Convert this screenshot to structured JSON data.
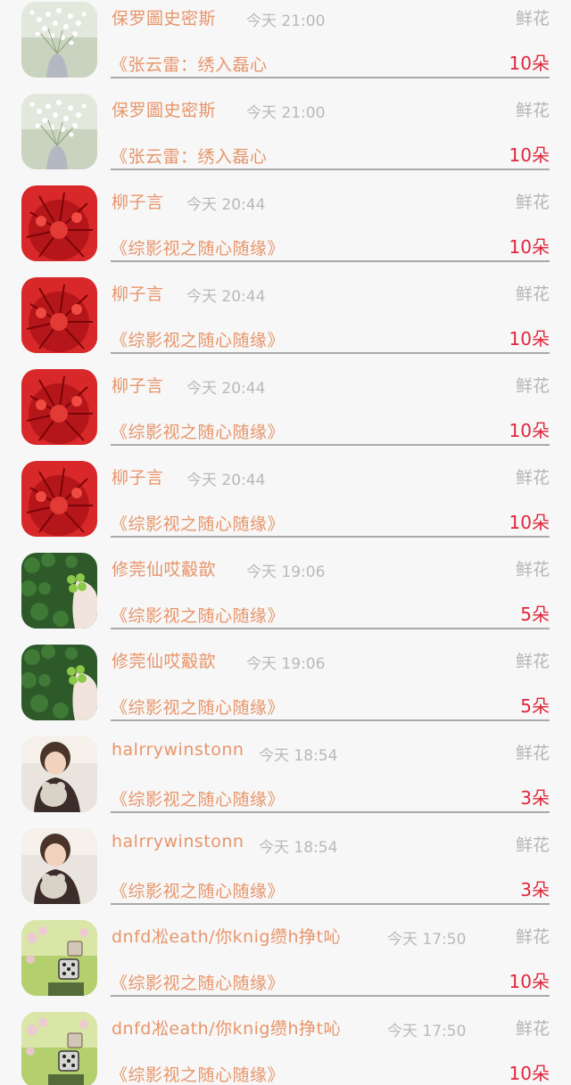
{
  "rows": [
    {
      "name": "保罗圖史密斯",
      "time": "今天 21:00",
      "gift_type": "鲜花",
      "book": "《张云雷：绣入磊心",
      "count": "10朵",
      "avatar_icon": "baby-breath-flowers-avatar"
    },
    {
      "name": "保罗圖史密斯",
      "time": "今天 21:00",
      "gift_type": "鲜花",
      "book": "《张云雷：绣入磊心",
      "count": "10朵",
      "avatar_icon": "baby-breath-flowers-avatar"
    },
    {
      "name": "柳子言",
      "time": "今天 20:44",
      "gift_type": "鲜花",
      "book": "《综影视之随心随缘》",
      "count": "10朵",
      "avatar_icon": "red-spider-lily-avatar"
    },
    {
      "name": "柳子言",
      "time": "今天 20:44",
      "gift_type": "鲜花",
      "book": "《综影视之随心随缘》",
      "count": "10朵",
      "avatar_icon": "red-spider-lily-avatar"
    },
    {
      "name": "柳子言",
      "time": "今天 20:44",
      "gift_type": "鲜花",
      "book": "《综影视之随心随缘》",
      "count": "10朵",
      "avatar_icon": "red-spider-lily-avatar"
    },
    {
      "name": "柳子言",
      "time": "今天 20:44",
      "gift_type": "鲜花",
      "book": "《综影视之随心随缘》",
      "count": "10朵",
      "avatar_icon": "red-spider-lily-avatar"
    },
    {
      "name": "修莞仙哎觳歆",
      "time": "今天 19:06",
      "gift_type": "鲜花",
      "book": "《综影视之随心随缘》",
      "count": "5朵",
      "avatar_icon": "four-leaf-clover-avatar"
    },
    {
      "name": "修莞仙哎觳歆",
      "time": "今天 19:06",
      "gift_type": "鲜花",
      "book": "《综影视之随心随缘》",
      "count": "5朵",
      "avatar_icon": "four-leaf-clover-avatar"
    },
    {
      "name": "halrrywinstonn",
      "time": "今天 18:54",
      "gift_type": "鲜花",
      "book": "《综影视之随心随缘》",
      "count": "3朵",
      "avatar_icon": "child-with-plush-avatar"
    },
    {
      "name": "halrrywinstonn",
      "time": "今天 18:54",
      "gift_type": "鲜花",
      "book": "《综影视之随心随缘》",
      "count": "3朵",
      "avatar_icon": "child-with-plush-avatar"
    },
    {
      "name": "dnfd凇eath/你knig缵h挣t吣",
      "time": "今天 17:50",
      "gift_type": "鲜花",
      "book": "《综影视之随心随缘》",
      "count": "10朵",
      "avatar_icon": "dice-bokeh-avatar"
    },
    {
      "name": "dnfd凇eath/你knig缵h挣t吣",
      "time": "今天 17:50",
      "gift_type": "鲜花",
      "book": "《综影视之随心随缘》",
      "count": "10朵",
      "avatar_icon": "dice-bokeh-avatar"
    }
  ]
}
